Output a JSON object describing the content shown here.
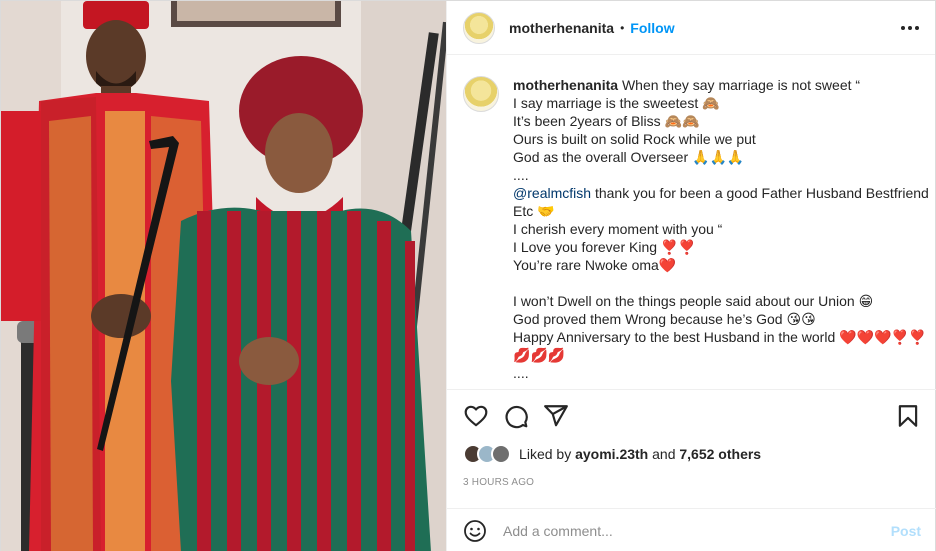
{
  "post": {
    "username": "motherhenanita",
    "separator": "•",
    "follow_label": "Follow"
  },
  "caption": {
    "username": "motherhenanita",
    "lines": [
      "When they say marriage is not sweet “",
      "I say marriage is the sweetest 🙈",
      "It’s been 2years of Bliss 🙈🙈",
      "Ours is built on solid Rock while we put",
      "God as the overall Overseer 🙏🙏🙏",
      "....",
      "thank you for been a good Father Husband Bestfriend",
      "Etc 🤝",
      "I cherish every moment with you “",
      "I Love you forever King ❣️❣️",
      "You’re rare Nwoke oma❤️",
      "",
      "I won’t Dwell on the things people said about our Union 😁",
      "God proved them Wrong because he’s God 😘😘",
      "Happy Anniversary to the best Husband in the world ❤️❤️❤️❣️❣️",
      "💋💋💋",
      "...."
    ],
    "mention": "@realmcfish"
  },
  "likes": {
    "prefix": "Liked by",
    "user": "ayomi.23th",
    "joiner": "and",
    "others": "7,652 others"
  },
  "timestamp": "3 HOURS AGO",
  "comment_box": {
    "placeholder": "Add a comment...",
    "post_label": "Post"
  },
  "icons": {
    "more": "more-options-icon",
    "like": "heart-icon",
    "comment": "comment-bubble-icon",
    "share": "paper-plane-icon",
    "save": "bookmark-icon",
    "emoji": "smiley-icon"
  },
  "colors": {
    "accent": "#0095f6",
    "mention": "#00376b",
    "post_disabled": "#b2dffc",
    "muted": "#8e8e8e"
  }
}
